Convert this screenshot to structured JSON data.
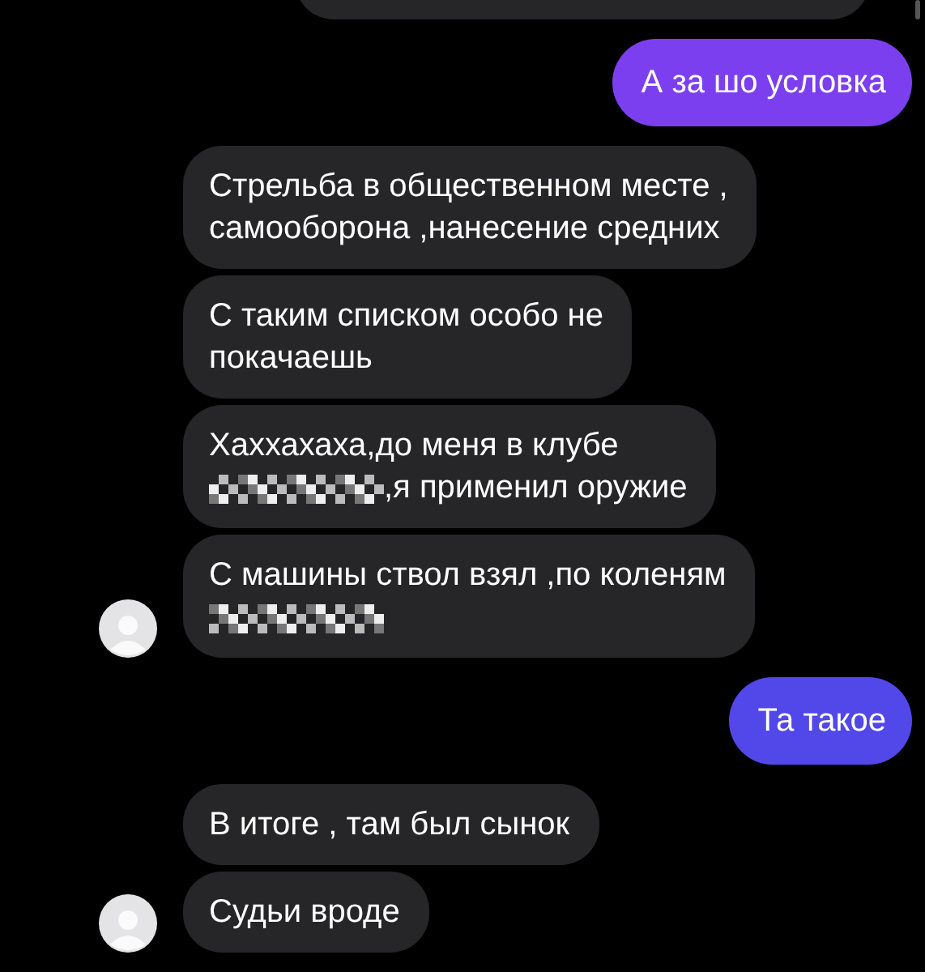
{
  "messages": [
    {
      "kind": "cut_off"
    },
    {
      "kind": "sent",
      "color": "#7b3ff0",
      "segments": [
        {
          "kind": "text",
          "text": "А за шо условка"
        }
      ]
    },
    {
      "kind": "received",
      "avatar": false,
      "segments": [
        {
          "kind": "text",
          "text": "Стрельба в общественном месте ,\nсамооборона ,нанесение средних"
        }
      ]
    },
    {
      "kind": "received",
      "avatar": false,
      "segments": [
        {
          "kind": "text",
          "text": "С таким списком особо не\nпокачаешь"
        }
      ]
    },
    {
      "kind": "received",
      "avatar": false,
      "segments": [
        {
          "kind": "text",
          "text": "Хаххахаха,до меня в клубе"
        },
        {
          "kind": "break"
        },
        {
          "kind": "redacted"
        },
        {
          "kind": "text",
          "text": ",я применил оружие"
        }
      ]
    },
    {
      "kind": "received",
      "avatar": true,
      "segments": [
        {
          "kind": "text",
          "text": "С машины ствол взял ,по коленям"
        },
        {
          "kind": "break"
        },
        {
          "kind": "redacted"
        }
      ]
    },
    {
      "kind": "sent",
      "color": "#5247e8",
      "segments": [
        {
          "kind": "text",
          "text": "Та такое"
        }
      ]
    },
    {
      "kind": "received",
      "avatar": false,
      "segments": [
        {
          "kind": "text",
          "text": "В итоге , там был сынок"
        }
      ]
    },
    {
      "kind": "received",
      "avatar": true,
      "segments": [
        {
          "kind": "text",
          "text": "Судьи вроде"
        }
      ]
    }
  ]
}
